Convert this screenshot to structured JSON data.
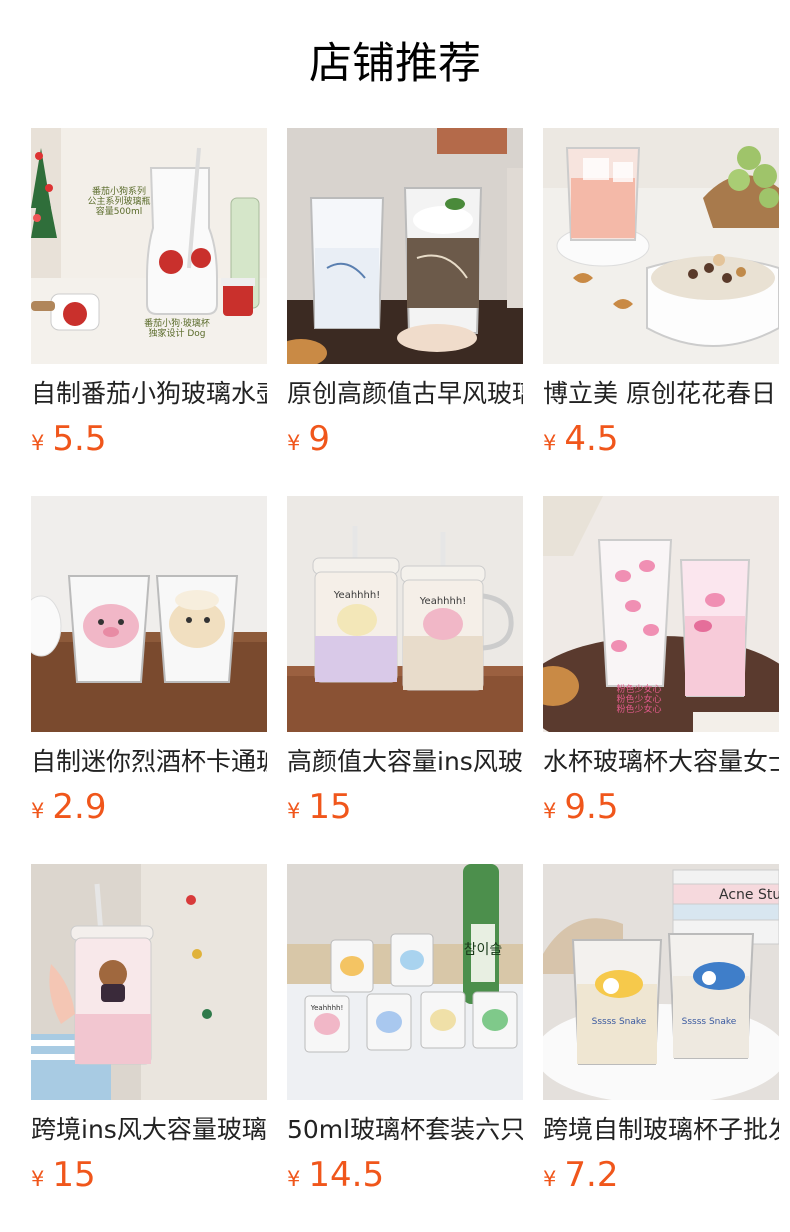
{
  "page_title": "店铺推荐",
  "currency_symbol": "¥",
  "products": [
    {
      "name": "自制番茄小狗玻璃水壶",
      "price": "5.5",
      "image_icon": "product-photo",
      "image_text": [
        "番茄小狗系列",
        "公主系列玻璃瓶",
        "容量500ml",
        "番茄小狗·玻璃杯",
        "独家设计 Dog"
      ]
    },
    {
      "name": "原创高颜值古早风玻璃杯",
      "price": "9",
      "image_icon": "product-photo"
    },
    {
      "name": "博立美 原创花花春日",
      "price": "4.5",
      "image_icon": "product-photo"
    },
    {
      "name": "自制迷你烈酒杯卡通玻璃",
      "price": "2.9",
      "image_icon": "product-photo"
    },
    {
      "name": "高颜值大容量ins风玻璃",
      "price": "15",
      "image_icon": "product-photo",
      "image_text": [
        "Yeahhhh!",
        "Yeahhhh!"
      ]
    },
    {
      "name": "水杯玻璃杯大容量女士",
      "price": "9.5",
      "image_icon": "product-photo",
      "image_text": [
        "粉色少女心",
        "粉色少女心",
        "粉色少女心"
      ]
    },
    {
      "name": "跨境ins风大容量玻璃杯",
      "price": "15",
      "image_icon": "product-photo"
    },
    {
      "name": "50ml玻璃杯套装六只",
      "price": "14.5",
      "image_icon": "product-photo",
      "image_text": [
        "참이슬",
        "Yeahhhh!"
      ]
    },
    {
      "name": "跨境自制玻璃杯子批发",
      "price": "7.2",
      "image_icon": "product-photo",
      "image_text": [
        "Acne Stu",
        "Sssss Snake",
        "Sssss Snake"
      ]
    }
  ],
  "colors": {
    "price": "#f0561b",
    "title": "#000000",
    "name": "#222222"
  }
}
